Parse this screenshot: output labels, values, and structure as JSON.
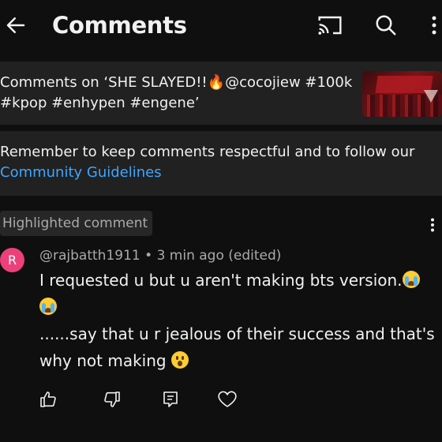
{
  "header": {
    "title": "Comments",
    "back_icon": "arrow-left-icon",
    "cast_icon": "cast-icon",
    "search_icon": "search-icon",
    "more_icon": "more-vert-icon"
  },
  "video": {
    "title_line1": "Comments on ‘SHE SLAYED!!🔥@cocojiew #100k",
    "title_line2": "#kpop #enhypen #engene’"
  },
  "notice": {
    "text": "Remember to keep comments respectful and to follow our",
    "link": "Community Guidelines"
  },
  "comment": {
    "badge": "Highlighted comment",
    "avatar_letter": "R",
    "author": "@rajbatth1911",
    "separator": " • ",
    "time": "3 min ago (edited)",
    "line1": "I requested u but u aren't making bts version.",
    "line3": "......say that u r jealous of their success and that's",
    "line4": "why not making",
    "actions": {
      "like_icon": "thumb-up-icon",
      "dislike_icon": "thumb-down-icon",
      "reply_icon": "reply-icon",
      "heart_icon": "heart-icon"
    }
  },
  "colors": {
    "background": "#0f0f0f",
    "panel": "#212121",
    "link": "#3ea6ff",
    "avatar": "#ec407a",
    "secondary_text": "#aaaaaa"
  }
}
